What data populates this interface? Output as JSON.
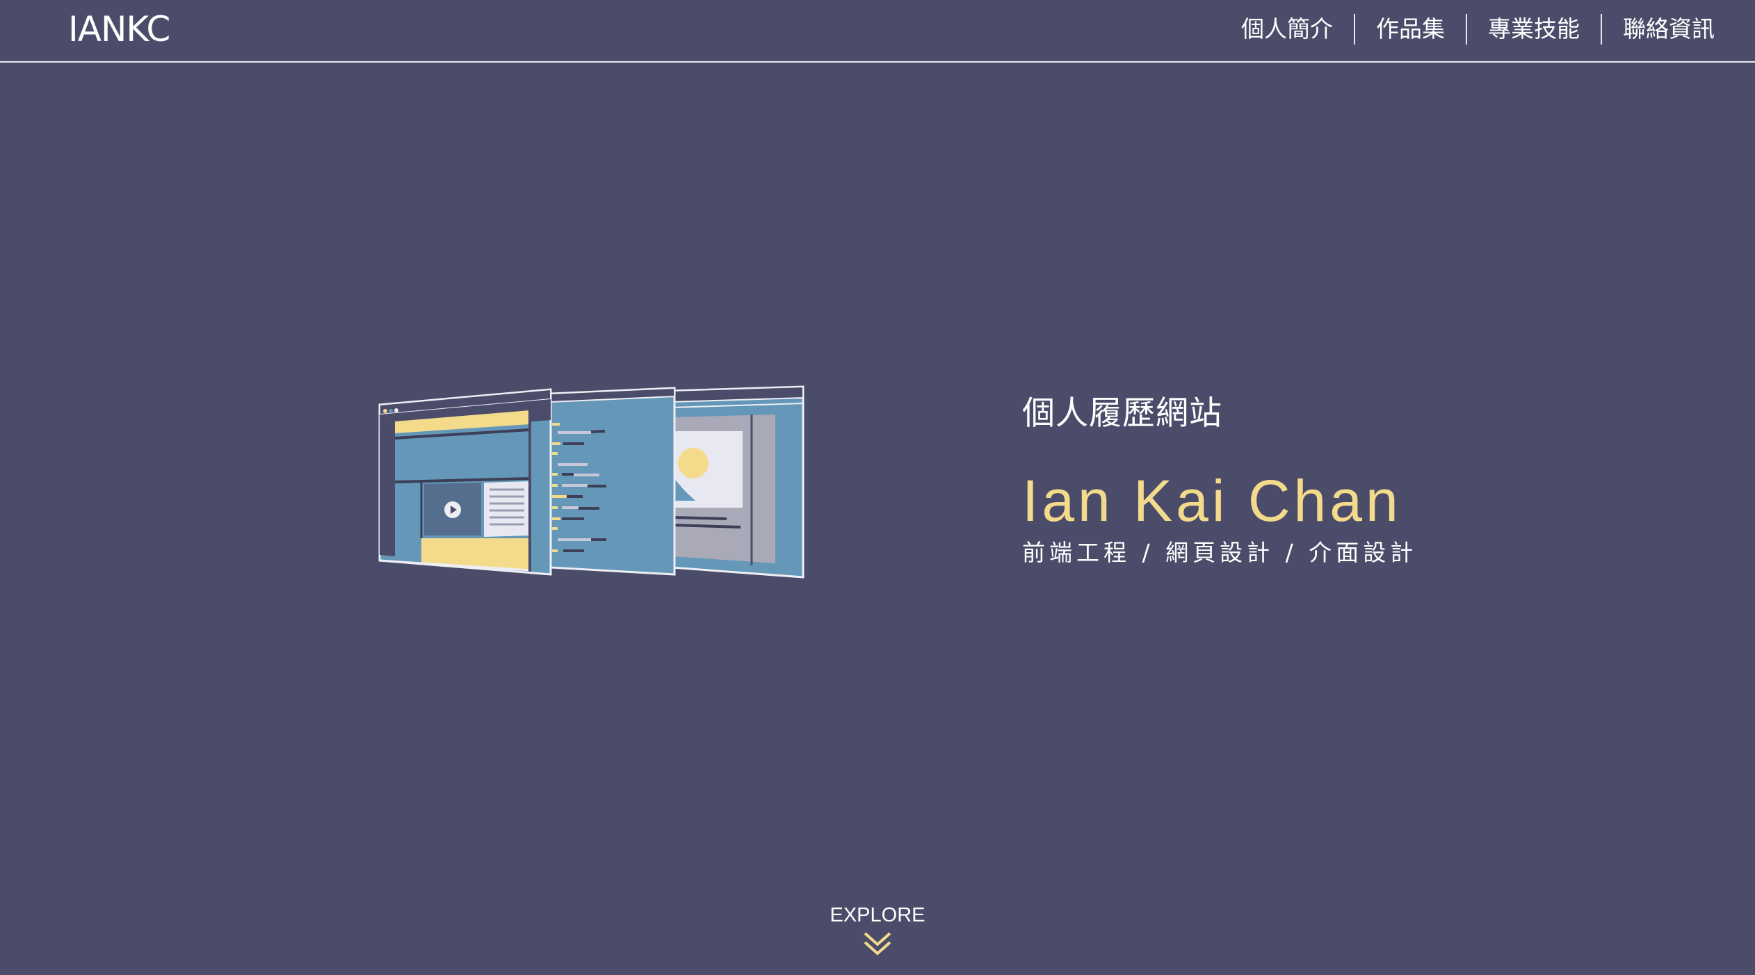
{
  "header": {
    "logo": "IANKC",
    "nav": [
      {
        "label": "個人簡介"
      },
      {
        "label": "作品集"
      },
      {
        "label": "專業技能"
      },
      {
        "label": "聯絡資訊"
      }
    ]
  },
  "hero": {
    "subtitle": "個人履歷網站",
    "name": "Ian Kai Chan",
    "roles": "前端工程 / 網頁設計 / 介面設計"
  },
  "explore": {
    "label": "EXPLORE",
    "icon": "double-chevron-down-icon"
  },
  "colors": {
    "background": "#4b4c69",
    "accent": "#f4db8c",
    "panel_blue": "#6497b8",
    "text": "#ffffff"
  }
}
